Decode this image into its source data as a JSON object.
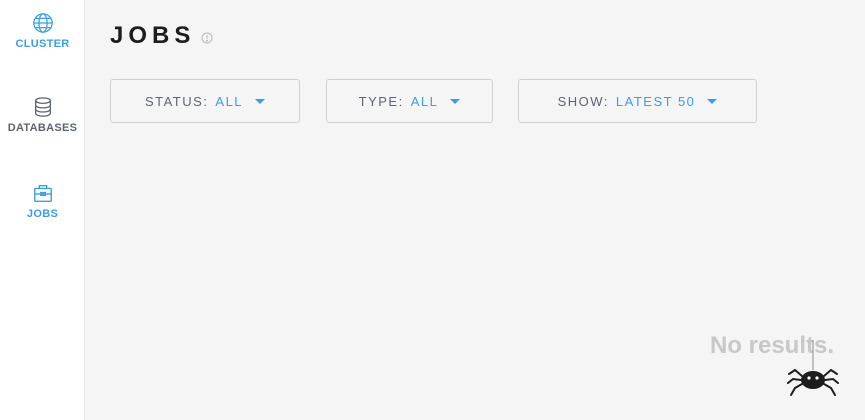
{
  "sidebar": {
    "items": [
      {
        "label": "CLUSTER",
        "icon": "globe-icon"
      },
      {
        "label": "DATABASES",
        "icon": "database-icon"
      },
      {
        "label": "JOBS",
        "icon": "briefcase-icon"
      }
    ]
  },
  "header": {
    "title": "JOBS",
    "info_icon": "info-icon"
  },
  "filters": {
    "status": {
      "label": "STATUS:",
      "value": "ALL"
    },
    "type": {
      "label": "TYPE:",
      "value": "ALL"
    },
    "show": {
      "label": "SHOW:",
      "value": "LATEST 50"
    }
  },
  "empty_state": {
    "message": "No results.",
    "icon": "spider-icon"
  },
  "colors": {
    "accent": "#3a9fe0",
    "text_dark": "#1d1d1d",
    "text_muted": "#5d6470",
    "empty_text": "#c8c8c8",
    "background": "#f5f5f5"
  }
}
